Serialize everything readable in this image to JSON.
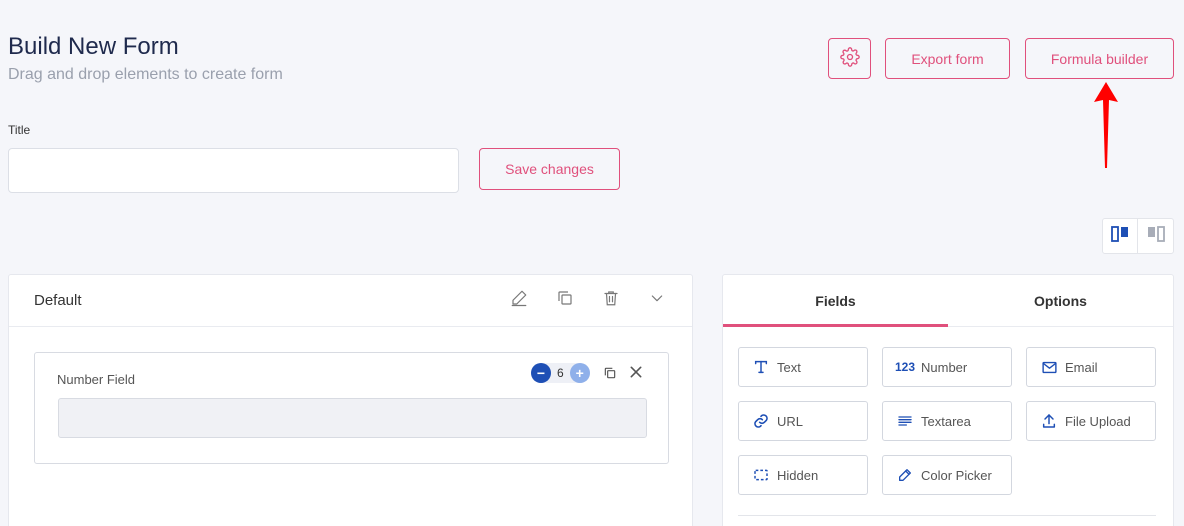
{
  "header": {
    "title": "Build New Form",
    "subtitle": "Drag and drop elements to create form",
    "settings_icon": "gear-icon",
    "export_label": "Export form",
    "formula_label": "Formula builder"
  },
  "form": {
    "title_label": "Title",
    "title_value": "",
    "title_placeholder": "",
    "save_label": "Save changes"
  },
  "layout_toggle": {
    "options": [
      "columns-left-icon",
      "columns-right-icon"
    ]
  },
  "section": {
    "title": "Default",
    "actions": [
      "edit-icon",
      "copy-icon",
      "trash-icon",
      "chevron-down-icon"
    ],
    "field": {
      "label": "Number Field",
      "width": "6"
    }
  },
  "panel": {
    "tabs": [
      {
        "label": "Fields",
        "active": true
      },
      {
        "label": "Options",
        "active": false
      }
    ],
    "field_types": [
      {
        "label": "Text",
        "icon": "text-icon"
      },
      {
        "label": "Number",
        "icon": "number-icon",
        "glyph": "123"
      },
      {
        "label": "Email",
        "icon": "email-icon"
      },
      {
        "label": "URL",
        "icon": "link-icon"
      },
      {
        "label": "Textarea",
        "icon": "textarea-icon"
      },
      {
        "label": "File Upload",
        "icon": "upload-icon"
      },
      {
        "label": "Hidden",
        "icon": "hidden-icon"
      },
      {
        "label": "Color Picker",
        "icon": "color-picker-icon"
      }
    ]
  },
  "colors": {
    "accent": "#e0507c",
    "primary": "#1e4fb5",
    "annotation_arrow": "#ff0000"
  }
}
